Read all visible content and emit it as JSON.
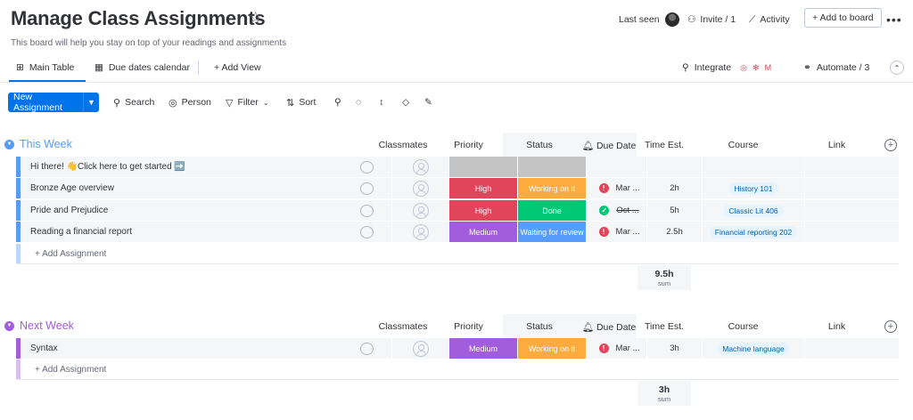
{
  "header": {
    "title": "Manage Class Assignments",
    "subtitle": "This board will help you stay on top of your readings and assignments",
    "last_seen": "Last seen",
    "invite": "Invite / 1",
    "activity": "Activity",
    "add_to_board": "+ Add to board",
    "more": "•••"
  },
  "tabs": {
    "main_table": "Main Table",
    "due_dates_calendar": "Due dates calendar",
    "add_view": "+ Add View",
    "integrate": "Integrate",
    "automate": "Automate / 3"
  },
  "toolbar": {
    "new_assignment": "New Assignment",
    "search": "Search",
    "person": "Person",
    "filter": "Filter",
    "sort": "Sort"
  },
  "columns": {
    "classmates": "Classmates",
    "priority": "Priority",
    "status": "Status",
    "due_date": "Due Date",
    "time_est": "Time Est.",
    "course": "Course",
    "link": "Link"
  },
  "groups": [
    {
      "title": "This Week",
      "color": "#579bfc",
      "rows": [
        {
          "name": "Hi there! 👋Click here to get started ➡️",
          "priority": "",
          "priority_color": "#c4c4c4",
          "status": "",
          "status_color": "#c4c4c4",
          "due_icon": "",
          "due": "",
          "time": "",
          "course": ""
        },
        {
          "name": "Bronze Age overview",
          "priority": "High",
          "priority_color": "#e2445c",
          "status": "Working on it",
          "status_color": "#fdab3d",
          "due_icon": "!",
          "due": "Mar ...",
          "time": "2h",
          "course": "History 101"
        },
        {
          "name": "Pride and Prejudice",
          "priority": "High",
          "priority_color": "#e2445c",
          "status": "Done",
          "status_color": "#00c875",
          "due_icon": "✓",
          "due": "Oct ...",
          "time": "5h",
          "course": "Classic Lit 406"
        },
        {
          "name": "Reading a financial report",
          "priority": "Medium",
          "priority_color": "#a25ddc",
          "status": "Waiting for review",
          "status_color": "#579bfc",
          "due_icon": "!",
          "due": "Mar ...",
          "time": "2.5h",
          "course": "Financial reporting 202"
        }
      ],
      "add_label": "+ Add Assignment",
      "sum_value": "9.5h",
      "sum_label": "sum"
    },
    {
      "title": "Next Week",
      "color": "#a25ddc",
      "rows": [
        {
          "name": "Syntax",
          "priority": "Medium",
          "priority_color": "#a25ddc",
          "status": "Working on it",
          "status_color": "#fdab3d",
          "due_icon": "!",
          "due": "Mar ...",
          "time": "3h",
          "course": "Machine language"
        }
      ],
      "add_label": "+ Add Assignment",
      "sum_value": "3h",
      "sum_label": "sum"
    }
  ]
}
